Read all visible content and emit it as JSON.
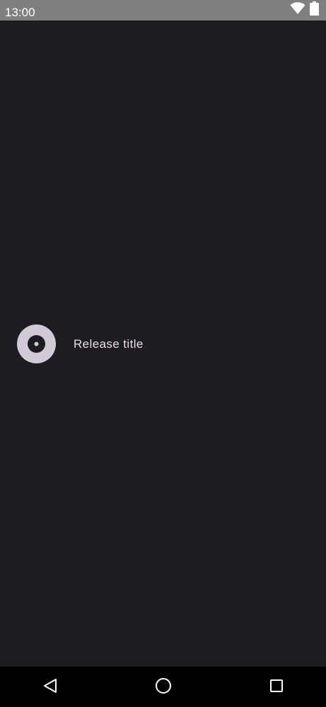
{
  "status_bar": {
    "time": "13:00",
    "icons": [
      "wifi-icon",
      "battery-icon"
    ]
  },
  "list": {
    "items": [
      {
        "icon": "disc-icon",
        "title": "Release title"
      }
    ]
  },
  "nav_bar": {
    "buttons": [
      "back-icon",
      "home-icon",
      "recents-icon"
    ]
  },
  "colors": {
    "background": "#1d1c21",
    "status_bar": "#7f7f7f",
    "nav_bar": "#000000",
    "icon_circle": "#d2c9d6",
    "text": "#e6e1e8"
  }
}
